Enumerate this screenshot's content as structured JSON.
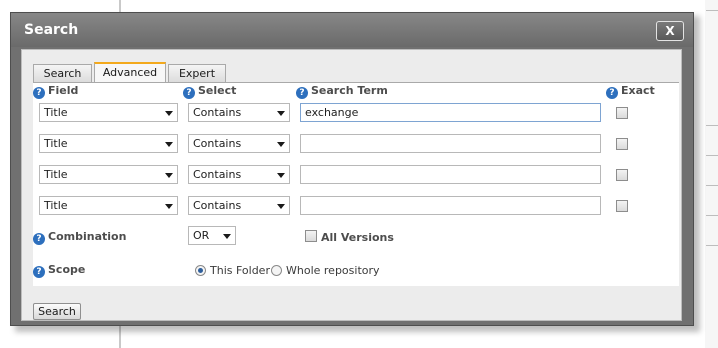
{
  "dialog": {
    "title": "Search",
    "close_label": "X"
  },
  "tabs": [
    {
      "label": "Search",
      "active": false
    },
    {
      "label": "Advanced",
      "active": true
    },
    {
      "label": "Expert",
      "active": false
    }
  ],
  "headers": {
    "field": "Field",
    "select": "Select",
    "search_term": "Search Term",
    "exact": "Exact"
  },
  "help_icon_glyph": "?",
  "rows": [
    {
      "field": "Title",
      "select": "Contains",
      "term": "exchange",
      "exact": false
    },
    {
      "field": "Title",
      "select": "Contains",
      "term": "",
      "exact": false
    },
    {
      "field": "Title",
      "select": "Contains",
      "term": "",
      "exact": false
    },
    {
      "field": "Title",
      "select": "Contains",
      "term": "",
      "exact": false
    }
  ],
  "combination": {
    "label": "Combination",
    "value": "OR"
  },
  "all_versions": {
    "label": "All Versions",
    "checked": false
  },
  "scope": {
    "label": "Scope",
    "options": [
      {
        "label": "This Folder",
        "selected": true
      },
      {
        "label": "Whole repository",
        "selected": false
      }
    ]
  },
  "search_button_label": "Search",
  "colors": {
    "title_bar": "#707070",
    "help_icon": "#2d6fbd",
    "active_tab_accent": "#f3a91c"
  }
}
